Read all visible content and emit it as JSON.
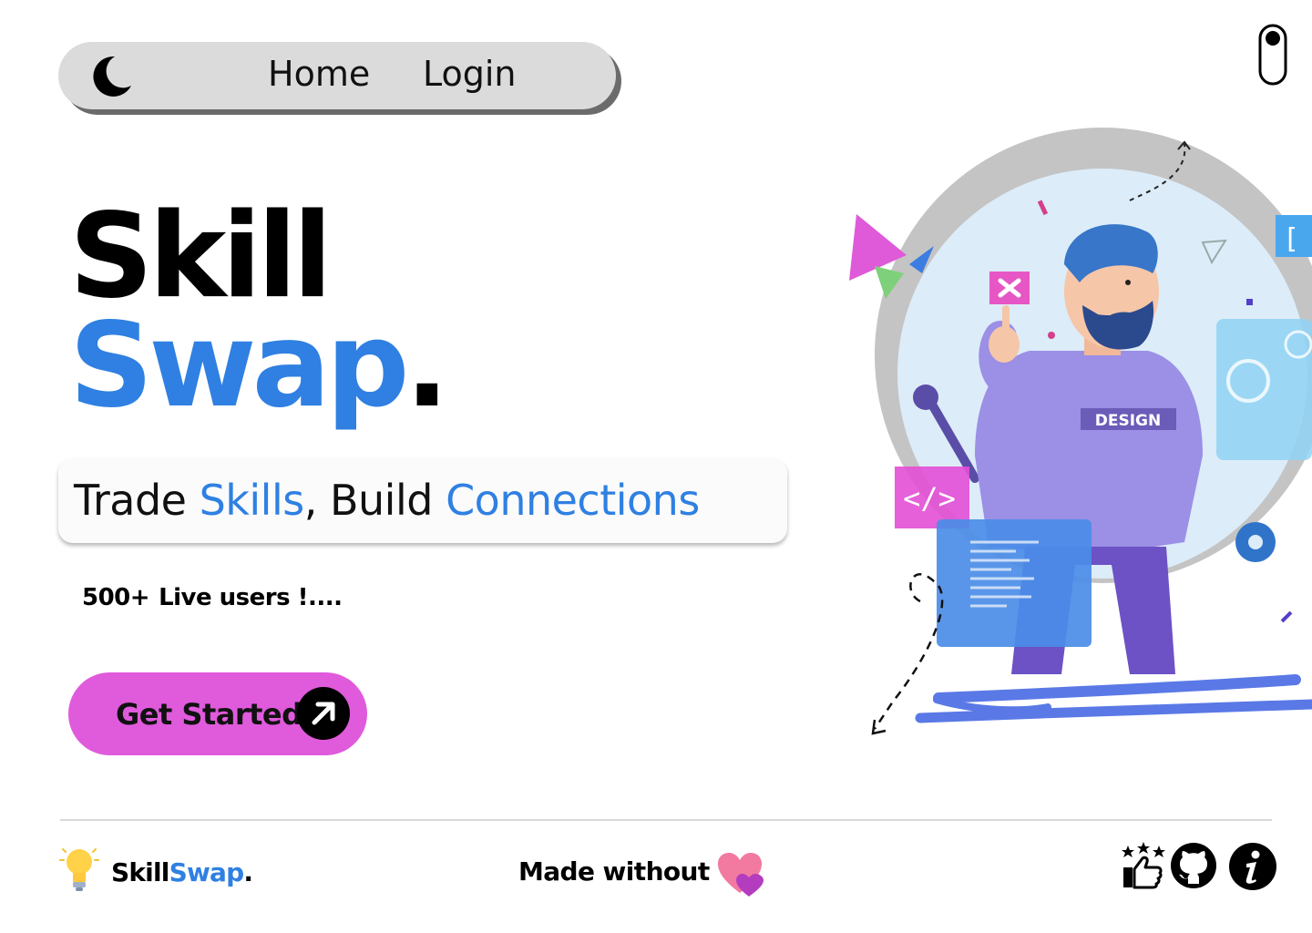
{
  "nav": {
    "theme_icon": "moon-icon",
    "home_label": "Home",
    "login_label": "Login"
  },
  "toggle_icon": "toggle-switch-icon",
  "hero": {
    "title_line1": "Skill",
    "title_line2": "Swap",
    "title_dot": ".",
    "tagline": {
      "part1": "Trade ",
      "part2": "Skills",
      "part3": ", Build ",
      "part4": "Connections"
    },
    "users_count": "500+",
    "users_text": "Live users !....",
    "cta_label": "Get Started",
    "cta_icon": "arrow-up-right-icon",
    "illustration_badge": "DESIGN",
    "illustration_code_tag": "</>"
  },
  "footer": {
    "logo_icon": "lightbulb-icon",
    "brand_part1": "Skill",
    "brand_part2": "Swap",
    "brand_dot": ".",
    "made_text": "Made without",
    "heart_icon": "heart-icon",
    "icons": [
      "thumbs-up-stars-icon",
      "github-icon",
      "info-icon"
    ]
  },
  "colors": {
    "accent_blue": "#2f80e2",
    "cta_pink": "#e05adc",
    "nav_bg": "#dcdbdc"
  }
}
